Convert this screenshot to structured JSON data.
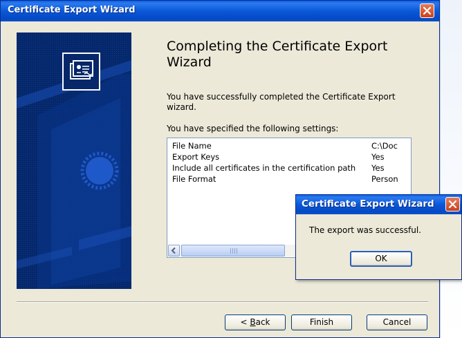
{
  "wizard": {
    "title": "Certificate Export Wizard",
    "heading": "Completing the Certificate Export Wizard",
    "success_text": "You have successfully completed the Certificate Export wizard.",
    "settings_intro": "You have specified the following settings:",
    "settings": [
      {
        "name": "File Name",
        "value": "C:\\Doc"
      },
      {
        "name": "Export Keys",
        "value": "Yes"
      },
      {
        "name": "Include all certificates in the certification path",
        "value": "Yes"
      },
      {
        "name": "File Format",
        "value": "Person"
      }
    ],
    "buttons": {
      "back_prefix": "< ",
      "back_mnemonic": "B",
      "back_rest": "ack",
      "finish": "Finish",
      "cancel": "Cancel"
    }
  },
  "message_box": {
    "title": "Certificate Export Wizard",
    "message": "The export was successful.",
    "ok": "OK"
  },
  "icons": {
    "close": "close-icon",
    "certificate": "certificate-icon",
    "scroll_left": "scroll-left-arrow-icon"
  },
  "colors": {
    "titlebar": "#0a58d8",
    "window_bg": "#ece9d8",
    "banner": "#062769",
    "close_button": "#d5502b"
  }
}
